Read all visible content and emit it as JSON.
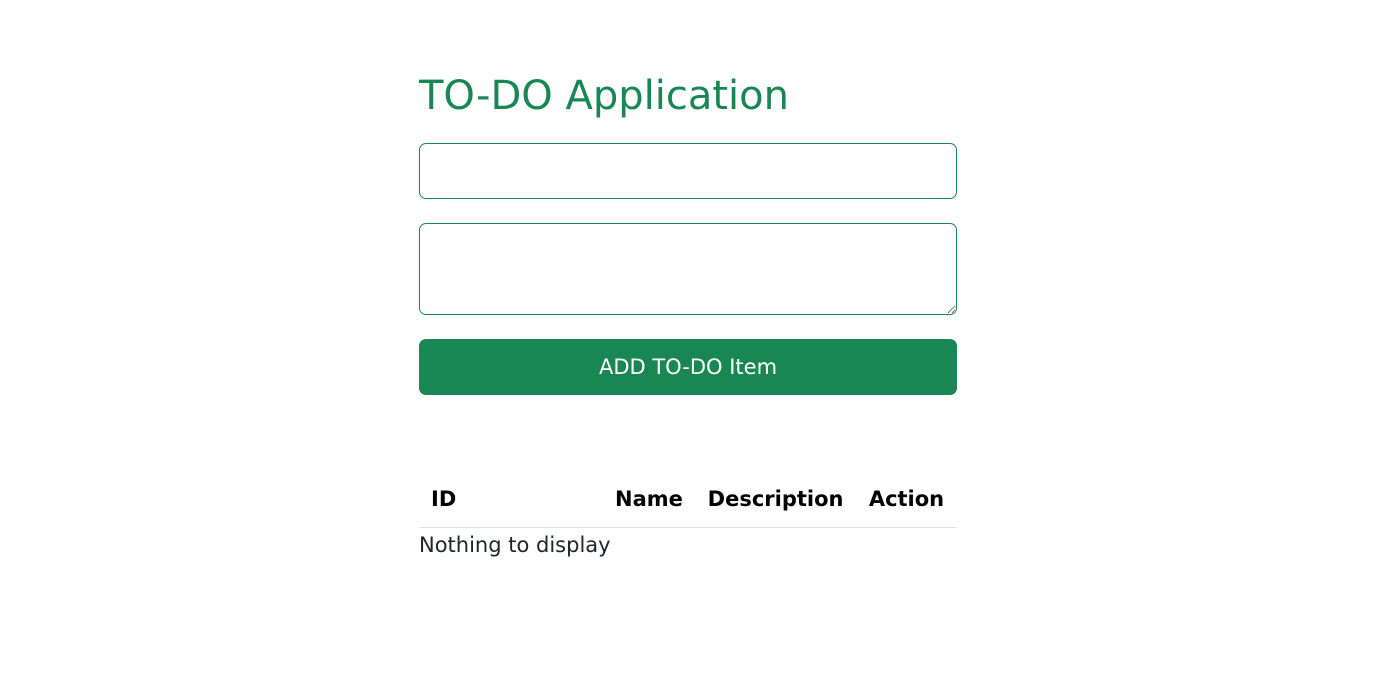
{
  "header": {
    "title": "TO-DO Application"
  },
  "form": {
    "name_value": "",
    "name_placeholder": "",
    "description_value": "",
    "description_placeholder": "",
    "add_label": "ADD TO-DO Item"
  },
  "table": {
    "columns": [
      "ID",
      "Name",
      "Description",
      "Action"
    ],
    "rows": [],
    "empty_message": "Nothing to display"
  },
  "colors": {
    "accent": "#198754",
    "text": "#212529",
    "background": "#ffffff"
  }
}
